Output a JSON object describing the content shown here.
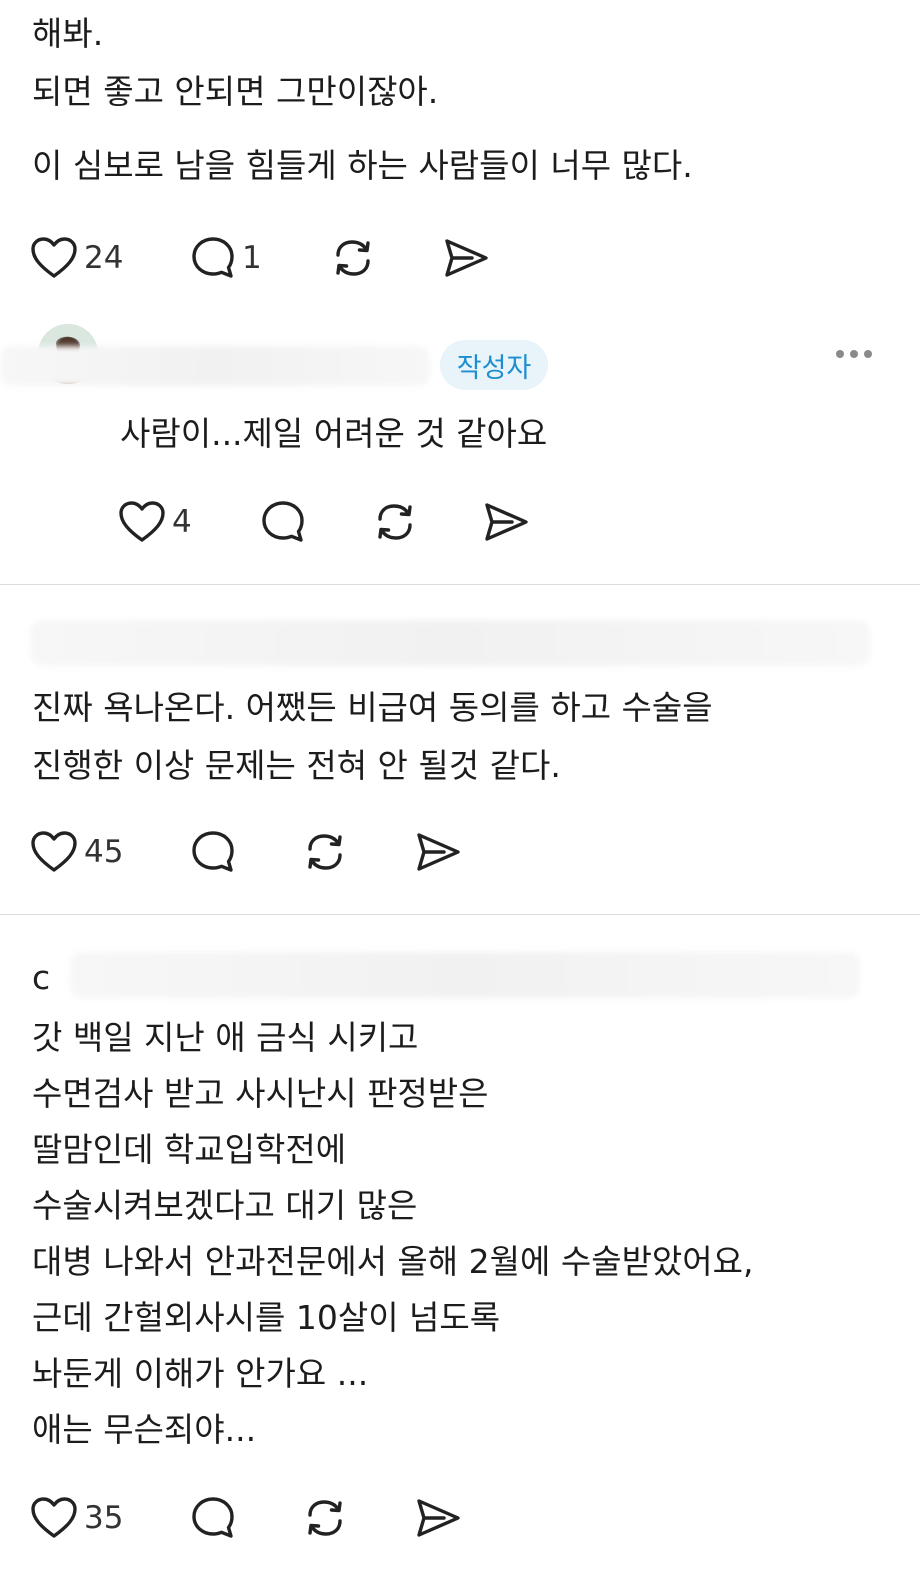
{
  "post1": {
    "lines": [
      "해봐.",
      "되면 좋고 안되면 그만이잖아."
    ],
    "extra_line": "이 심보로 남을 힘들게 하는 사람들이 너무 많다.",
    "likes": "24",
    "comments": "1"
  },
  "reply": {
    "badge": "작성자",
    "text": "사람이...제일 어려운 것 같아요",
    "likes": "4"
  },
  "post2": {
    "lines": [
      "진짜 욕나온다. 어쨌든 비급여 동의를 하고 수술을",
      "진행한 이상 문제는 전혀 안 될것 같다."
    ],
    "likes": "45"
  },
  "post3": {
    "handle": "c",
    "lines": [
      "갓 백일 지난 애 금식 시키고",
      "수면검사 받고 사시난시 판정받은",
      "딸맘인데 학교입학전에",
      "수술시켜보겠다고 대기 많은",
      "대병 나와서 안과전문에서 올해 2월에 수술받았어요,",
      "근데 간헐외사시를 10살이 넘도록",
      "놔둔게 이해가 안가요 ...",
      "애는 무슨죄야..."
    ],
    "likes": "35"
  },
  "icons": {
    "like": "heart-icon",
    "comment": "comment-bubble-icon",
    "repost": "repost-arrows-icon",
    "share": "send-icon",
    "more": "more-dots-icon"
  },
  "colors": {
    "badge_text": "#1d8fd1",
    "badge_bg": "#e8f3fa",
    "icon": "#222222"
  }
}
